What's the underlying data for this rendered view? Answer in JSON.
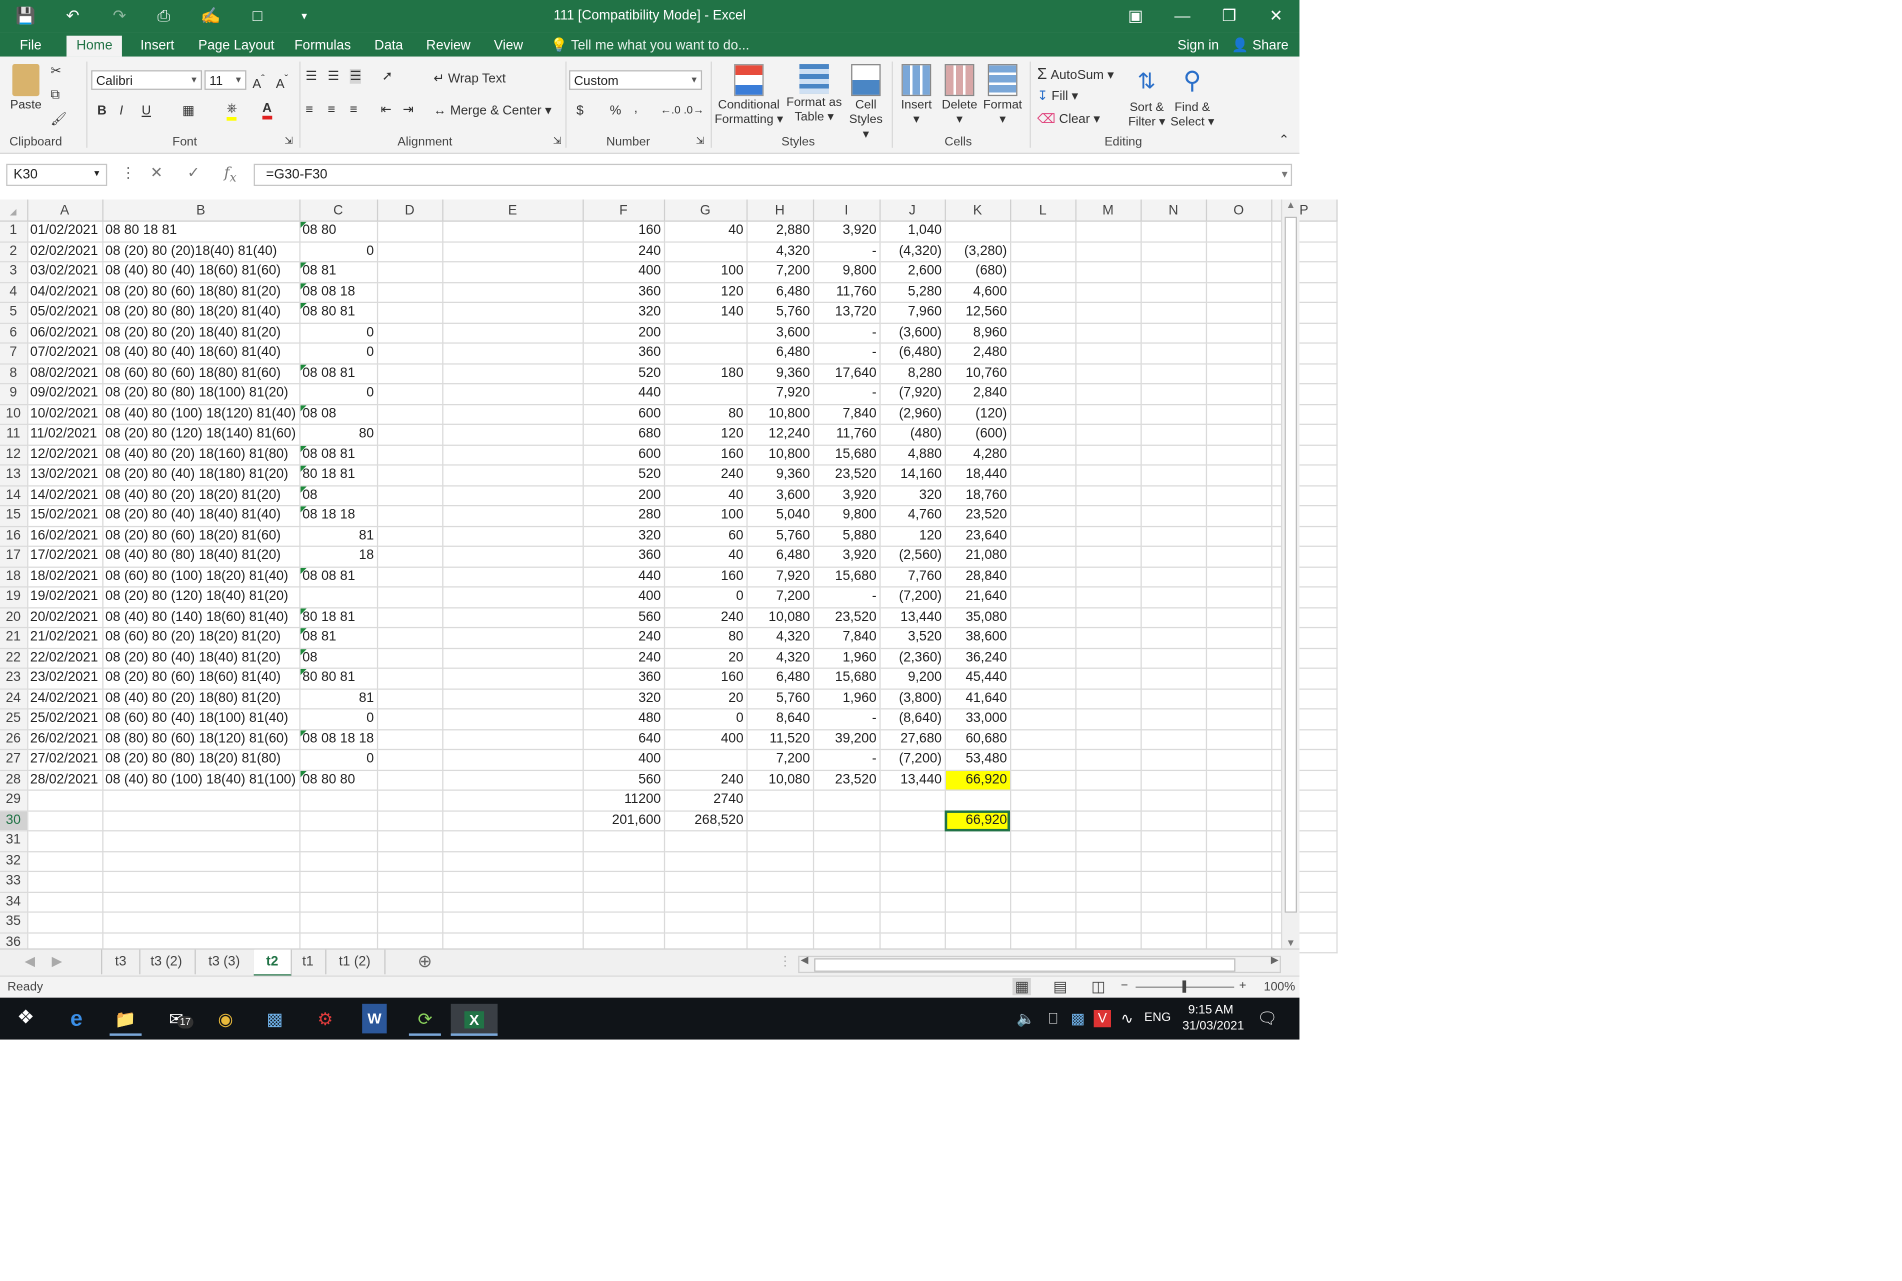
{
  "window": {
    "title": "111  [Compatibility Mode] - Excel",
    "sign_in": "Sign in",
    "share": "Share",
    "tell_me": "Tell me what you want to do..."
  },
  "ribbon_tabs": [
    "File",
    "Home",
    "Insert",
    "Page Layout",
    "Formulas",
    "Data",
    "Review",
    "View"
  ],
  "ribbon": {
    "clipboard": {
      "paste": "Paste",
      "label": "Clipboard"
    },
    "font": {
      "name": "Calibri",
      "size": "11",
      "label": "Font",
      "bold": "B",
      "italic": "I",
      "underline": "U"
    },
    "alignment": {
      "wrap_text": "Wrap Text",
      "merge_center": "Merge & Center",
      "label": "Alignment"
    },
    "number": {
      "format": "Custom",
      "label": "Number",
      "currency": "$",
      "percent": "%",
      "comma": "‚"
    },
    "styles": {
      "conditional": "Conditional",
      "conditional2": "Formatting",
      "format_as": "Format as",
      "format_as2": "Table",
      "cell": "Cell",
      "cell2": "Styles",
      "label": "Styles"
    },
    "cells": {
      "insert": "Insert",
      "delete": "Delete",
      "format": "Format",
      "label": "Cells"
    },
    "editing": {
      "autosum": "AutoSum",
      "fill": "Fill",
      "clear": "Clear",
      "sort": "Sort &",
      "sort2": "Filter",
      "find": "Find &",
      "find2": "Select",
      "label": "Editing"
    }
  },
  "formula_bar": {
    "name_box": "K30",
    "formula": "=G30-F30"
  },
  "columns": [
    "A",
    "B",
    "C",
    "D",
    "E",
    "F",
    "G",
    "H",
    "I",
    "J",
    "K",
    "L",
    "M",
    "N",
    "O",
    "P"
  ],
  "rows": [
    [
      "01/02/2021",
      "08 80 18 81",
      "08 80",
      "",
      "",
      "160",
      "40",
      "2,880",
      "3,920",
      "1,040",
      ""
    ],
    [
      "02/02/2021",
      "08 (20) 80 (20)18(40) 81(40)",
      "0",
      "",
      "",
      "240",
      "",
      "4,320",
      "-",
      "(4,320)",
      "(3,280)"
    ],
    [
      "03/02/2021",
      "08 (40) 80 (40) 18(60) 81(60)",
      "08 81",
      "",
      "",
      "400",
      "100",
      "7,200",
      "9,800",
      "2,600",
      "(680)"
    ],
    [
      "04/02/2021",
      "08 (20) 80 (60) 18(80) 81(20)",
      "08 08 18",
      "",
      "",
      "360",
      "120",
      "6,480",
      "11,760",
      "5,280",
      "4,600"
    ],
    [
      "05/02/2021",
      "08 (20) 80 (80) 18(20) 81(40)",
      "08 80 81",
      "",
      "",
      "320",
      "140",
      "5,760",
      "13,720",
      "7,960",
      "12,560"
    ],
    [
      "06/02/2021",
      "08 (20) 80 (20) 18(40) 81(20)",
      "0",
      "",
      "",
      "200",
      "",
      "3,600",
      "-",
      "(3,600)",
      "8,960"
    ],
    [
      "07/02/2021",
      "08 (40) 80 (40) 18(60) 81(40)",
      "0",
      "",
      "",
      "360",
      "",
      "6,480",
      "-",
      "(6,480)",
      "2,480"
    ],
    [
      "08/02/2021",
      "08 (60) 80 (60) 18(80) 81(60)",
      "08 08 81",
      "",
      "",
      "520",
      "180",
      "9,360",
      "17,640",
      "8,280",
      "10,760"
    ],
    [
      "09/02/2021",
      "08 (20) 80 (80) 18(100) 81(20)",
      "0",
      "",
      "",
      "440",
      "",
      "7,920",
      "-",
      "(7,920)",
      "2,840"
    ],
    [
      "10/02/2021",
      "08 (40) 80 (100) 18(120) 81(40)",
      "08 08",
      "",
      "",
      "600",
      "80",
      "10,800",
      "7,840",
      "(2,960)",
      "(120)"
    ],
    [
      "11/02/2021",
      "08 (20) 80 (120) 18(140) 81(60)",
      "80",
      "",
      "",
      "680",
      "120",
      "12,240",
      "11,760",
      "(480)",
      "(600)"
    ],
    [
      "12/02/2021",
      "08 (40) 80 (20) 18(160) 81(80)",
      "08 08 81",
      "",
      "",
      "600",
      "160",
      "10,800",
      "15,680",
      "4,880",
      "4,280"
    ],
    [
      "13/02/2021",
      "08 (20) 80 (40) 18(180) 81(20)",
      "80 18 81",
      "",
      "",
      "520",
      "240",
      "9,360",
      "23,520",
      "14,160",
      "18,440"
    ],
    [
      "14/02/2021",
      "08 (40) 80 (20) 18(20) 81(20)",
      "08",
      "",
      "",
      "200",
      "40",
      "3,600",
      "3,920",
      "320",
      "18,760"
    ],
    [
      "15/02/2021",
      "08 (20) 80 (40) 18(40) 81(40)",
      "08 18 18",
      "",
      "",
      "280",
      "100",
      "5,040",
      "9,800",
      "4,760",
      "23,520"
    ],
    [
      "16/02/2021",
      "08 (20) 80 (60) 18(20) 81(60)",
      "81",
      "",
      "",
      "320",
      "60",
      "5,760",
      "5,880",
      "120",
      "23,640"
    ],
    [
      "17/02/2021",
      "08 (40) 80 (80) 18(40) 81(20)",
      "18",
      "",
      "",
      "360",
      "40",
      "6,480",
      "3,920",
      "(2,560)",
      "21,080"
    ],
    [
      "18/02/2021",
      "08 (60) 80 (100) 18(20) 81(40)",
      "08 08 81",
      "",
      "",
      "440",
      "160",
      "7,920",
      "15,680",
      "7,760",
      "28,840"
    ],
    [
      "19/02/2021",
      "08 (20) 80 (120) 18(40) 81(20)",
      "",
      "",
      "",
      "400",
      "0",
      "7,200",
      "-",
      "(7,200)",
      "21,640"
    ],
    [
      "20/02/2021",
      "08 (40) 80 (140) 18(60) 81(40)",
      "80 18 81",
      "",
      "",
      "560",
      "240",
      "10,080",
      "23,520",
      "13,440",
      "35,080"
    ],
    [
      "21/02/2021",
      "08 (60) 80 (20) 18(20) 81(20)",
      "08 81",
      "",
      "",
      "240",
      "80",
      "4,320",
      "7,840",
      "3,520",
      "38,600"
    ],
    [
      "22/02/2021",
      "08 (20) 80 (40) 18(40) 81(20)",
      "08",
      "",
      "",
      "240",
      "20",
      "4,320",
      "1,960",
      "(2,360)",
      "36,240"
    ],
    [
      "23/02/2021",
      "08 (20) 80 (60) 18(60) 81(40)",
      "80 80 81",
      "",
      "",
      "360",
      "160",
      "6,480",
      "15,680",
      "9,200",
      "45,440"
    ],
    [
      "24/02/2021",
      "08 (40) 80 (20) 18(80) 81(20)",
      "81",
      "",
      "",
      "320",
      "20",
      "5,760",
      "1,960",
      "(3,800)",
      "41,640"
    ],
    [
      "25/02/2021",
      "08 (60) 80 (40) 18(100) 81(40)",
      "0",
      "",
      "",
      "480",
      "0",
      "8,640",
      "-",
      "(8,640)",
      "33,000"
    ],
    [
      "26/02/2021",
      "08 (80) 80 (60) 18(120) 81(60)",
      "08 08 18 18",
      "",
      "",
      "640",
      "400",
      "11,520",
      "39,200",
      "27,680",
      "60,680"
    ],
    [
      "27/02/2021",
      "08 (20) 80 (80) 18(20) 81(80)",
      "0",
      "",
      "",
      "400",
      "",
      "7,200",
      "-",
      "(7,200)",
      "53,480"
    ],
    [
      "28/02/2021",
      "08 (40) 80 (100) 18(40) 81(100)",
      "08 80 80",
      "",
      "",
      "560",
      "240",
      "10,080",
      "23,520",
      "13,440",
      "66,920"
    ],
    [
      "",
      "",
      "",
      "",
      "",
      "11200",
      "2740",
      "",
      "",
      "",
      ""
    ],
    [
      "",
      "",
      "",
      "",
      "",
      "201,600",
      "268,520",
      "",
      "",
      "",
      "66,920"
    ]
  ],
  "highlight_color": "#ffff00",
  "sheet_tabs": [
    "t3",
    "t3 (2)",
    "t3 (3)",
    "t2",
    "t1",
    "t1 (2)"
  ],
  "active_sheet": "t2",
  "status": {
    "ready": "Ready",
    "zoom": "100%"
  },
  "taskbar": {
    "time": "9:15 AM",
    "date": "31/03/2021",
    "lang": "ENG",
    "mail_badge": "17"
  },
  "accent": "#217346"
}
